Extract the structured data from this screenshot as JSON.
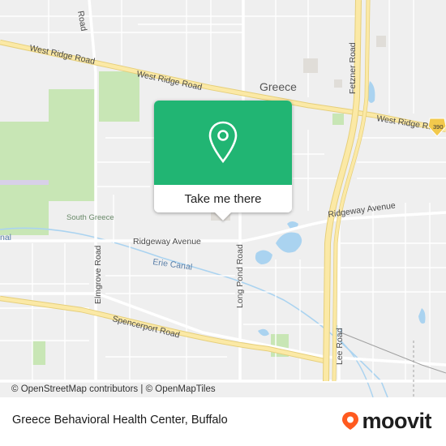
{
  "map": {
    "labels": {
      "place_greece": "Greece",
      "place_south_greece": "South Greece",
      "road_west_ridge_1": "West Ridge Road",
      "road_west_ridge_2": "West Ridge Road",
      "road_west_ridge_3": "West Ridge Road",
      "road_ridgeway_1": "Ridgeway Avenue",
      "road_ridgeway_2": "Ridgeway Avenue",
      "road_spencerport": "Spencerport Road",
      "road_elmgrove": "Elmgrove Road",
      "road_long_pond": "Long Pond Road",
      "road_fetzner": "Fetzner Road",
      "road_lee": "Lee Road",
      "road_top_left": "Road",
      "water_erie_canal": "Erie Canal",
      "edge_canal": "nal"
    },
    "shield": {
      "text": "390",
      "color": "#f2c94c"
    },
    "colors": {
      "background": "#efefef",
      "park": "#c8e6b5",
      "water": "#aad3f0",
      "major_road": "#fbe9a6",
      "road": "#ffffff",
      "accent": "#21b573"
    }
  },
  "attribution": {
    "copyright": "©",
    "osm": "OpenStreetMap contributors",
    "separator": "|",
    "copyright2": "©",
    "omt": "OpenMapTiles"
  },
  "popup": {
    "icon": "location-pin-icon",
    "button_label": "Take me there"
  },
  "footer": {
    "title": "Greece Behavioral Health Center, Buffalo",
    "brand": "moovit",
    "brand_color": "#ff5a1f"
  }
}
